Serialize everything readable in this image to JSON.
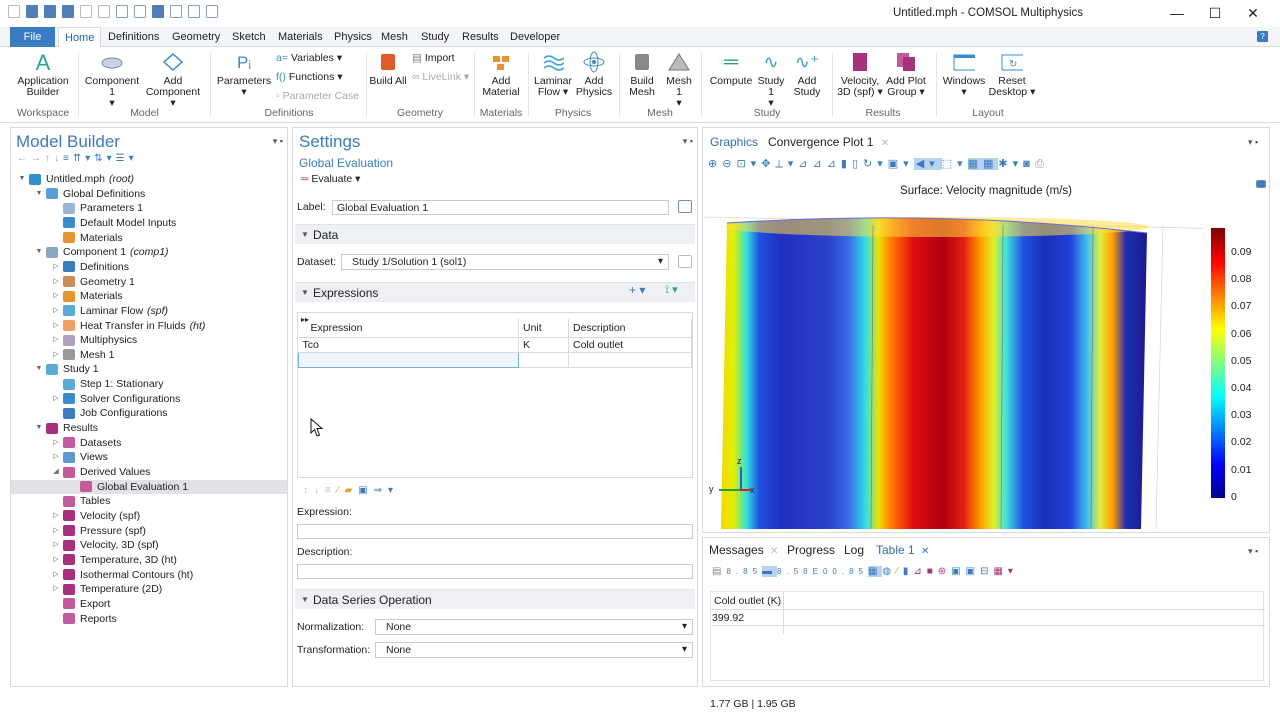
{
  "window": {
    "title": "Untitled.mph - COMSOL Multiphysics",
    "minimize": "—",
    "maximize": "☐",
    "close": "✕"
  },
  "ribbon_tabs": [
    "File",
    "Home",
    "Definitions",
    "Geometry",
    "Sketch",
    "Materials",
    "Physics",
    "Mesh",
    "Study",
    "Results",
    "Developer"
  ],
  "ribbon": {
    "app_builder": "Application Builder",
    "component": "Component 1",
    "add_component": "Add Component",
    "parameters": "Parameters",
    "variables": "Variables",
    "functions": "Functions",
    "parameter_case": "Parameter Case",
    "build_all": "Build All",
    "import": "Import",
    "livelink": "LiveLink",
    "add_material": "Add Material",
    "laminar_flow": "Laminar Flow",
    "add_physics": "Add Physics",
    "build_mesh": "Build Mesh",
    "mesh1": "Mesh 1",
    "compute": "Compute",
    "study1": "Study 1",
    "add_study": "Add Study",
    "velocity3d": "Velocity, 3D (spf)",
    "add_plot_group": "Add Plot Group",
    "windows": "Windows",
    "reset_desktop": "Reset Desktop",
    "groups": [
      "Workspace",
      "Model",
      "Definitions",
      "Geometry",
      "Materials",
      "Physics",
      "Mesh",
      "Study",
      "Results",
      "Layout"
    ]
  },
  "model_builder": {
    "title": "Model Builder",
    "tree": [
      {
        "label": "Untitled.mph",
        "tag": "(root)"
      },
      {
        "label": "Global Definitions",
        "tag": ""
      },
      {
        "label": "Parameters 1",
        "tag": ""
      },
      {
        "label": "Default Model Inputs",
        "tag": ""
      },
      {
        "label": "Materials",
        "tag": ""
      },
      {
        "label": "Component 1",
        "tag": "(comp1)"
      },
      {
        "label": "Definitions",
        "tag": ""
      },
      {
        "label": "Geometry 1",
        "tag": ""
      },
      {
        "label": "Materials",
        "tag": ""
      },
      {
        "label": "Laminar Flow",
        "tag": "(spf)"
      },
      {
        "label": "Heat Transfer in Fluids",
        "tag": "(ht)"
      },
      {
        "label": "Multiphysics",
        "tag": ""
      },
      {
        "label": "Mesh 1",
        "tag": ""
      },
      {
        "label": "Study 1",
        "tag": ""
      },
      {
        "label": "Step 1: Stationary",
        "tag": ""
      },
      {
        "label": "Solver Configurations",
        "tag": ""
      },
      {
        "label": "Job Configurations",
        "tag": ""
      },
      {
        "label": "Results",
        "tag": ""
      },
      {
        "label": "Datasets",
        "tag": ""
      },
      {
        "label": "Views",
        "tag": ""
      },
      {
        "label": "Derived Values",
        "tag": ""
      },
      {
        "label": "Global Evaluation 1",
        "tag": ""
      },
      {
        "label": "Tables",
        "tag": ""
      },
      {
        "label": "Velocity (spf)",
        "tag": ""
      },
      {
        "label": "Pressure (spf)",
        "tag": ""
      },
      {
        "label": "Velocity, 3D (spf)",
        "tag": ""
      },
      {
        "label": "Temperature, 3D (ht)",
        "tag": ""
      },
      {
        "label": "Isothermal Contours (ht)",
        "tag": ""
      },
      {
        "label": "Temperature (2D)",
        "tag": ""
      },
      {
        "label": "Export",
        "tag": ""
      },
      {
        "label": "Reports",
        "tag": ""
      }
    ]
  },
  "settings": {
    "title": "Settings",
    "subtitle": "Global Evaluation",
    "evaluate": "Evaluate",
    "label_caption": "Label:",
    "label_value": "Global Evaluation 1",
    "data_section": "Data",
    "dataset_caption": "Dataset:",
    "dataset_value": "Study 1/Solution 1 (sol1)",
    "expressions_section": "Expressions",
    "table_headers": [
      "Expression",
      "Unit",
      "Description"
    ],
    "table_rows": [
      {
        "expression": "Tco",
        "unit": "K",
        "description": "Cold outlet"
      }
    ],
    "expression_caption": "Expression:",
    "description_caption": "Description:",
    "dso_section": "Data Series Operation",
    "normalization_caption": "Normalization:",
    "normalization_value": "None",
    "transformation_caption": "Transformation:",
    "transformation_value": "None"
  },
  "graphics": {
    "tabs": [
      "Graphics",
      "Convergence Plot 1"
    ],
    "plot_title": "Surface: Velocity magnitude (m/s)",
    "colorbar_ticks": [
      "0.09",
      "0.08",
      "0.07",
      "0.06",
      "0.05",
      "0.04",
      "0.03",
      "0.02",
      "0.01",
      "0"
    ],
    "axis_x": "x",
    "axis_y": "y",
    "axis_z": "z"
  },
  "messages": {
    "tabs": [
      "Messages",
      "Progress",
      "Log",
      "Table 1"
    ],
    "table_header": "Cold outlet (K)",
    "table_value": "399.92"
  },
  "status": {
    "memory": "1.77 GB | 1.95 GB"
  }
}
